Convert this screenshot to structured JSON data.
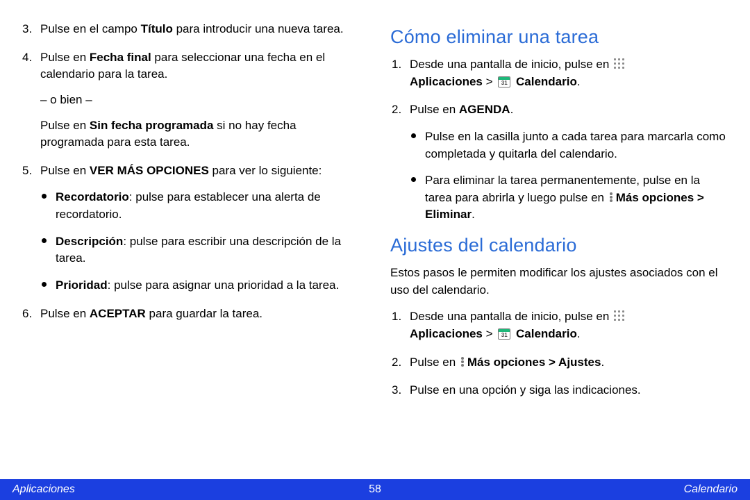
{
  "left": {
    "items": [
      {
        "pre": "Pulse en el campo ",
        "bold1": "Título",
        "post": " para introducir una nueva tarea."
      },
      {
        "pre": "Pulse en ",
        "bold1": "Fecha final",
        "mid": " para seleccionar una fecha en el calendario para la tarea.",
        "or": "– o bien –",
        "pre2": "Pulse en ",
        "bold2": "Sin fecha programada",
        "post2": " si no hay fecha programada para esta tarea."
      },
      {
        "pre": "Pulse en ",
        "bold1": "VER MÁS OPCIONES",
        "post": " para ver lo siguiente:",
        "bullets": [
          {
            "b": "Recordatorio",
            "t": ": pulse para establecer una alerta de recordatorio."
          },
          {
            "b": "Descripción",
            "t": ": pulse para escribir una descripción de la tarea."
          },
          {
            "b": "Prioridad",
            "t": ": pulse para asignar una prioridad a la tarea."
          }
        ]
      },
      {
        "pre": "Pulse en ",
        "bold1": "ACEPTAR",
        "post": " para guardar la tarea."
      }
    ]
  },
  "right": {
    "heading1": "Cómo eliminar una tarea",
    "sec1": {
      "step1_pre": "Desde una pantalla de inicio, pulse en ",
      "step1_apps": "Aplicaciones",
      "step1_gt": " > ",
      "step1_cal": "Calendario",
      "step1_end": ".",
      "step2_pre": "Pulse en ",
      "step2_b": "AGENDA",
      "step2_end": ".",
      "bullets": [
        "Pulse en la casilla junto a cada tarea para marcarla como completada y quitarla del calendario.",
        {
          "pre": "Para eliminar la tarea permanentemente, pulse en la tarea para abrirla y luego pulse en ",
          "b": "Más opciones > Eliminar",
          "end": "."
        }
      ]
    },
    "heading2": "Ajustes del calendario",
    "sec2_intro": "Estos pasos le permiten modificar los ajustes asociados con el uso del calendario.",
    "sec2": {
      "step1_pre": "Desde una pantalla de inicio, pulse en ",
      "step1_apps": "Aplicaciones",
      "step1_gt": " > ",
      "step1_cal": "Calendario",
      "step1_end": ".",
      "step2_pre": "Pulse en ",
      "step2_b": "Más opciones > Ajustes",
      "step2_end": ".",
      "step3": "Pulse en una opción y siga las indicaciones."
    }
  },
  "footer": {
    "left": "Aplicaciones",
    "center": "58",
    "right": "Calendario"
  },
  "cal_day": "31"
}
